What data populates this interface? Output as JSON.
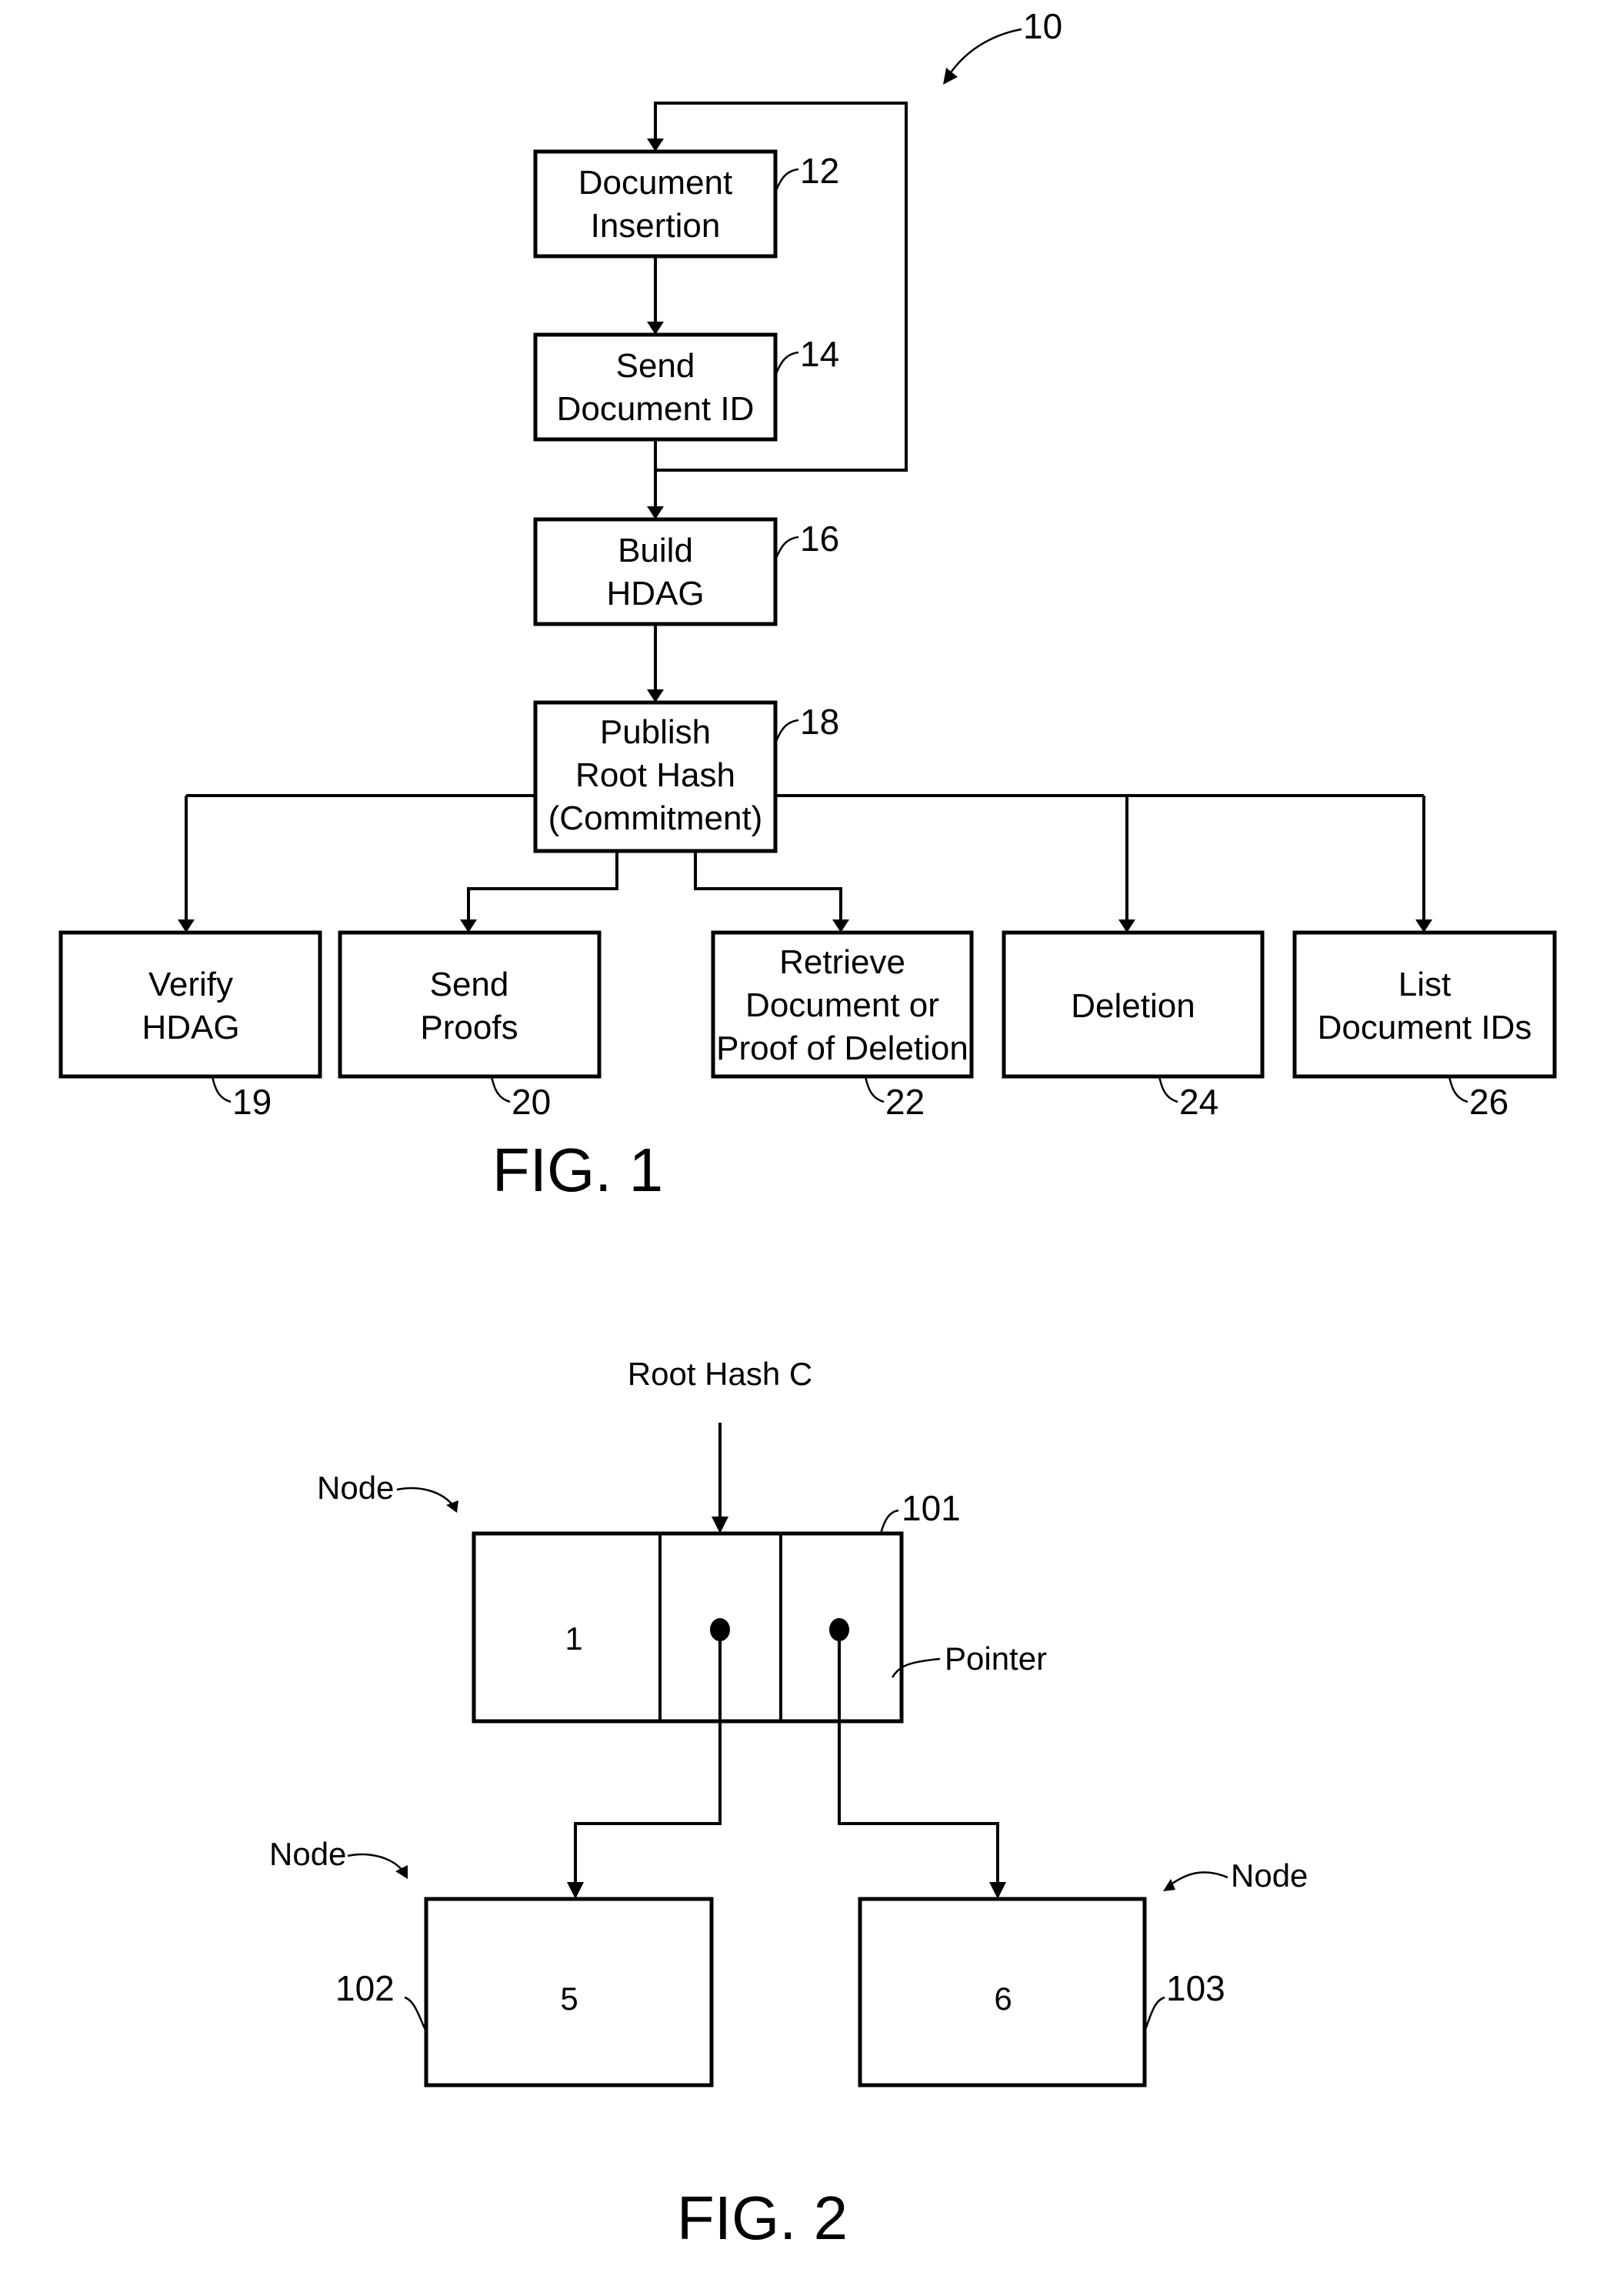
{
  "fig1": {
    "caption": "FIG. 1",
    "ref": "10",
    "steps": [
      {
        "id": "12",
        "lines": [
          "Document",
          "Insertion"
        ]
      },
      {
        "id": "14",
        "lines": [
          "Send",
          "Document ID"
        ]
      },
      {
        "id": "16",
        "lines": [
          "Build",
          "HDAG"
        ]
      },
      {
        "id": "18",
        "lines": [
          "Publish",
          "Root Hash",
          "(Commitment)"
        ]
      }
    ],
    "outcomes": [
      {
        "id": "19",
        "lines": [
          "Verify",
          "HDAG"
        ]
      },
      {
        "id": "20",
        "lines": [
          "Send",
          "Proofs"
        ]
      },
      {
        "id": "22",
        "lines": [
          "Retrieve",
          "Document or",
          "Proof of Deletion"
        ]
      },
      {
        "id": "24",
        "lines": [
          "Deletion"
        ]
      },
      {
        "id": "26",
        "lines": [
          "List",
          "Document IDs"
        ]
      }
    ]
  },
  "fig2": {
    "caption": "FIG. 2",
    "root_label": "Root Hash C",
    "pointer_label": "Pointer",
    "node_label": "Node",
    "root_node": {
      "id": "101",
      "value": "1"
    },
    "children": [
      {
        "id": "102",
        "value": "5"
      },
      {
        "id": "103",
        "value": "6"
      }
    ]
  }
}
